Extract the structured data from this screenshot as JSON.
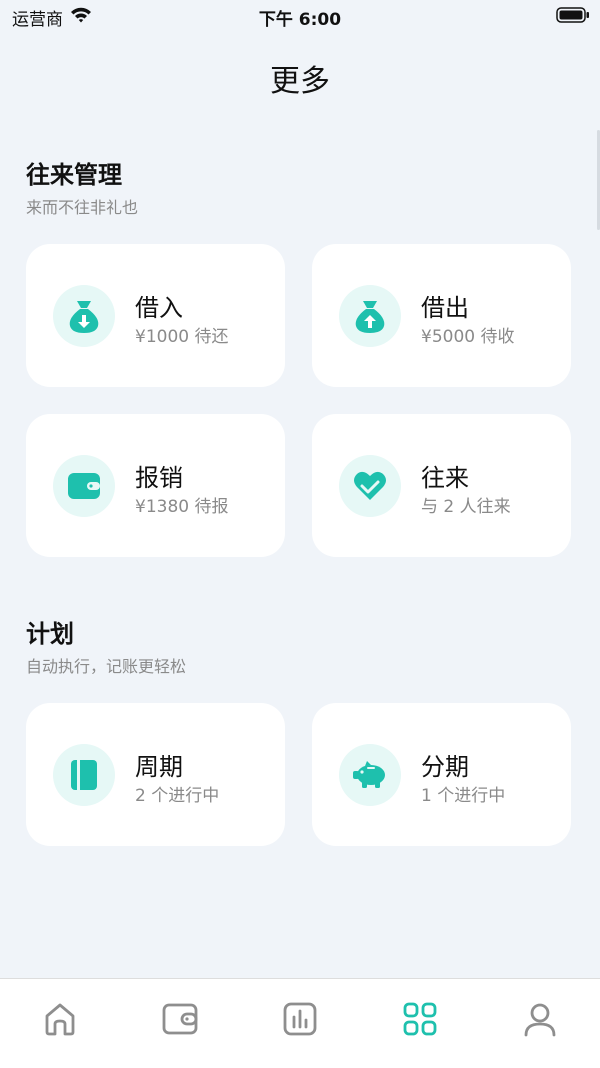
{
  "status_bar": {
    "carrier": "运营商",
    "time": "下午 6:00"
  },
  "page": {
    "title": "更多"
  },
  "sections": [
    {
      "title": "往来管理",
      "subtitle": "来而不往非礼也",
      "cards": [
        {
          "title": "借入",
          "subtitle": "¥1000 待还",
          "icon": "money-bag-down-icon"
        },
        {
          "title": "借出",
          "subtitle": "¥5000 待收",
          "icon": "money-bag-up-icon"
        },
        {
          "title": "报销",
          "subtitle": "¥1380 待报",
          "icon": "wallet-icon"
        },
        {
          "title": "往来",
          "subtitle": "与 2 人往来",
          "icon": "heart-handshake-icon"
        }
      ]
    },
    {
      "title": "计划",
      "subtitle": "自动执行，记账更轻松",
      "cards": [
        {
          "title": "周期",
          "subtitle": "2 个进行中",
          "icon": "notebook-icon"
        },
        {
          "title": "分期",
          "subtitle": "1 个进行中",
          "icon": "piggy-bank-icon"
        }
      ]
    }
  ],
  "tabbar": {
    "items": [
      {
        "icon": "home-icon",
        "active": false
      },
      {
        "icon": "wallet-icon",
        "active": false
      },
      {
        "icon": "chart-icon",
        "active": false
      },
      {
        "icon": "grid-icon",
        "active": true
      },
      {
        "icon": "user-icon",
        "active": false
      }
    ]
  },
  "colors": {
    "accent": "#1ec0ad",
    "accent_light": "#e6f8f6",
    "background": "#f0f4f9",
    "inactive_icon": "#8e8e8e"
  }
}
